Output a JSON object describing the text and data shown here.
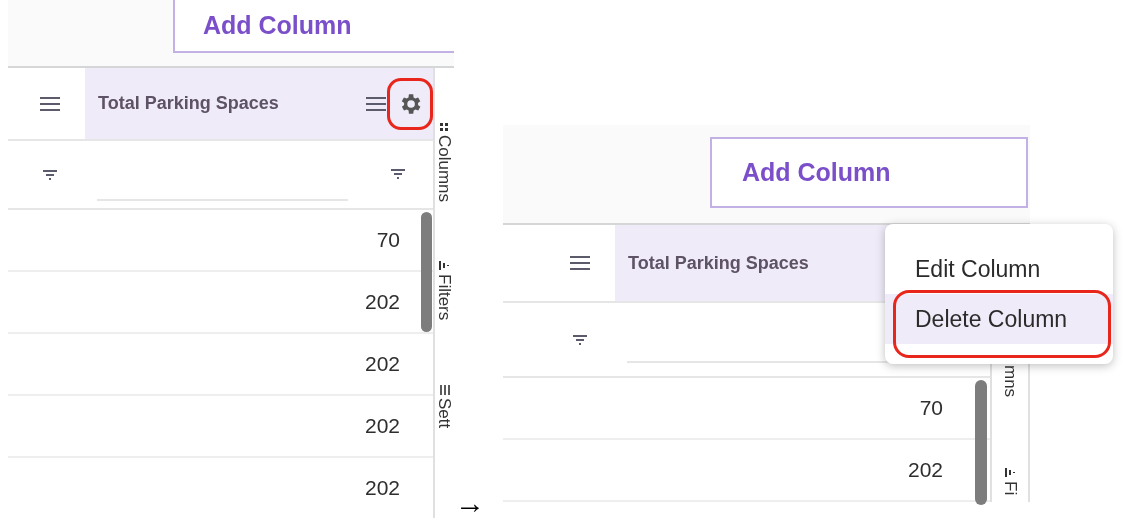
{
  "steps": [
    {
      "add_column_button": "Add Column",
      "header": "Total Parking Spaces",
      "gear_highlighted": true,
      "values": [
        "70",
        "202",
        "202",
        "202",
        "202"
      ],
      "side_tabs": [
        {
          "kind": "columns",
          "label": "Columns"
        },
        {
          "kind": "filters",
          "label": "Filters"
        },
        {
          "kind": "settings",
          "label": "Sett"
        }
      ]
    },
    {
      "add_column_button": "Add Column",
      "header": "Total Parking Spaces",
      "values": [
        "70",
        "202"
      ],
      "side_tabs": [
        {
          "kind": "columns",
          "label": "mns"
        },
        {
          "kind": "filters",
          "label": "Fi"
        }
      ],
      "menu": {
        "items": [
          {
            "label": "Edit Column",
            "selected": false,
            "highlighted": false
          },
          {
            "label": "Delete Column",
            "selected": true,
            "highlighted": true
          }
        ]
      }
    }
  ],
  "arrow": "→"
}
